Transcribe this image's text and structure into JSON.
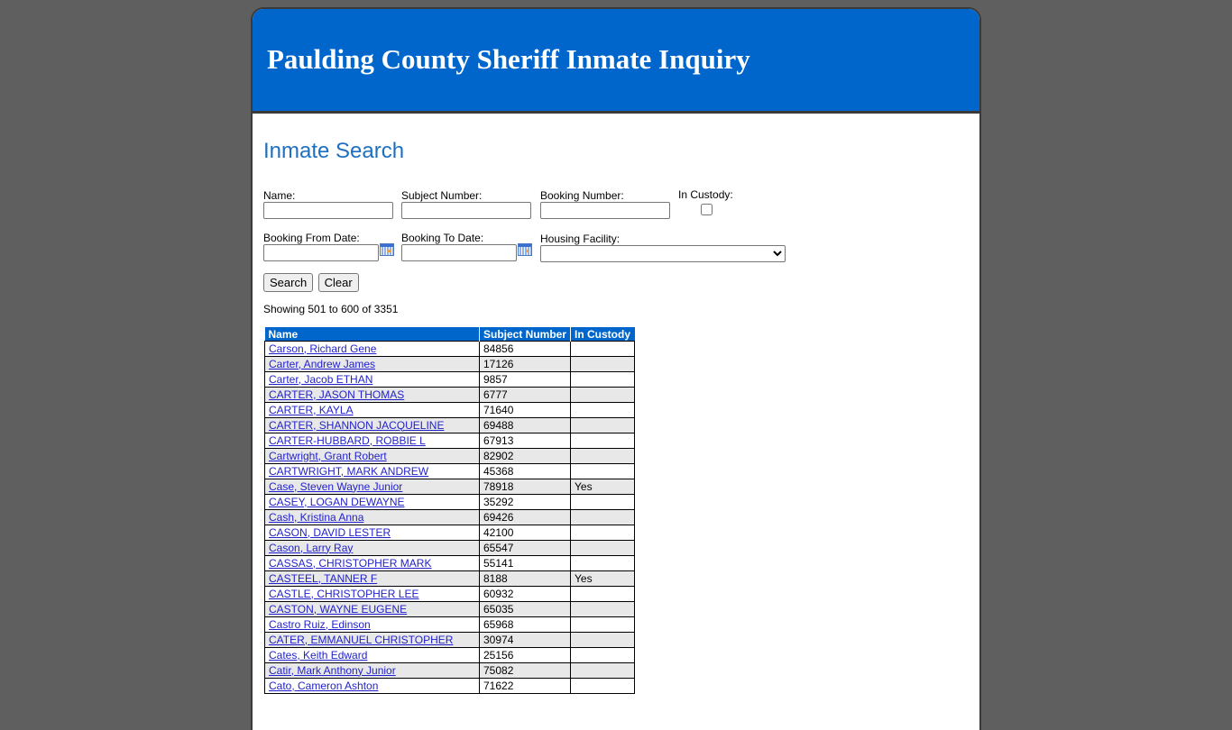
{
  "header": {
    "title": "Paulding County Sheriff Inmate Inquiry"
  },
  "search": {
    "title": "Inmate Search",
    "fields": {
      "name": {
        "label": "Name:",
        "value": ""
      },
      "subject_number": {
        "label": "Subject Number:",
        "value": ""
      },
      "booking_number": {
        "label": "Booking Number:",
        "value": ""
      },
      "in_custody": {
        "label": "In Custody:",
        "checked": false
      },
      "booking_from_date": {
        "label": "Booking From Date:",
        "value": ""
      },
      "booking_to_date": {
        "label": "Booking To Date:",
        "value": ""
      },
      "housing_facility": {
        "label": "Housing Facility:",
        "selected": ""
      }
    },
    "buttons": {
      "search": "Search",
      "clear": "Clear"
    }
  },
  "results": {
    "summary": "Showing 501 to 600 of 3351",
    "columns": [
      "Name",
      "Subject Number",
      "In Custody"
    ],
    "rows": [
      {
        "name": "Carson, Richard Gene",
        "subject": "84856",
        "custody": ""
      },
      {
        "name": "Carter, Andrew James",
        "subject": "17126",
        "custody": ""
      },
      {
        "name": "Carter, Jacob ETHAN",
        "subject": "9857",
        "custody": ""
      },
      {
        "name": "CARTER, JASON THOMAS",
        "subject": "6777",
        "custody": ""
      },
      {
        "name": "CARTER, KAYLA",
        "subject": "71640",
        "custody": ""
      },
      {
        "name": "CARTER, SHANNON JACQUELINE",
        "subject": "69488",
        "custody": ""
      },
      {
        "name": "CARTER-HUBBARD, ROBBIE L",
        "subject": "67913",
        "custody": ""
      },
      {
        "name": "Cartwright, Grant Robert",
        "subject": "82902",
        "custody": ""
      },
      {
        "name": "CARTWRIGHT, MARK ANDREW",
        "subject": "45368",
        "custody": ""
      },
      {
        "name": "Case, Steven Wayne Junior",
        "subject": "78918",
        "custody": "Yes"
      },
      {
        "name": "CASEY, LOGAN DEWAYNE",
        "subject": "35292",
        "custody": ""
      },
      {
        "name": "Cash, Kristina Anna",
        "subject": "69426",
        "custody": ""
      },
      {
        "name": "CASON, DAVID LESTER",
        "subject": "42100",
        "custody": ""
      },
      {
        "name": "Cason, Larry Ray",
        "subject": "65547",
        "custody": ""
      },
      {
        "name": "CASSAS, CHRISTOPHER MARK",
        "subject": "55141",
        "custody": ""
      },
      {
        "name": "CASTEEL, TANNER F",
        "subject": "8188",
        "custody": "Yes"
      },
      {
        "name": "CASTLE, CHRISTOPHER LEE",
        "subject": "60932",
        "custody": ""
      },
      {
        "name": "CASTON, WAYNE EUGENE",
        "subject": "65035",
        "custody": ""
      },
      {
        "name": "Castro Ruiz, Edinson",
        "subject": "65968",
        "custody": ""
      },
      {
        "name": "CATER, EMMANUEL CHRISTOPHER",
        "subject": "30974",
        "custody": ""
      },
      {
        "name": "Cates, Keith Edward",
        "subject": "25156",
        "custody": ""
      },
      {
        "name": "Catir, Mark Anthony Junior",
        "subject": "75082",
        "custody": ""
      },
      {
        "name": "Cato, Cameron Ashton",
        "subject": "71622",
        "custody": ""
      }
    ]
  },
  "colors": {
    "brand": "#0066cc",
    "background": "#5f5f5f"
  }
}
